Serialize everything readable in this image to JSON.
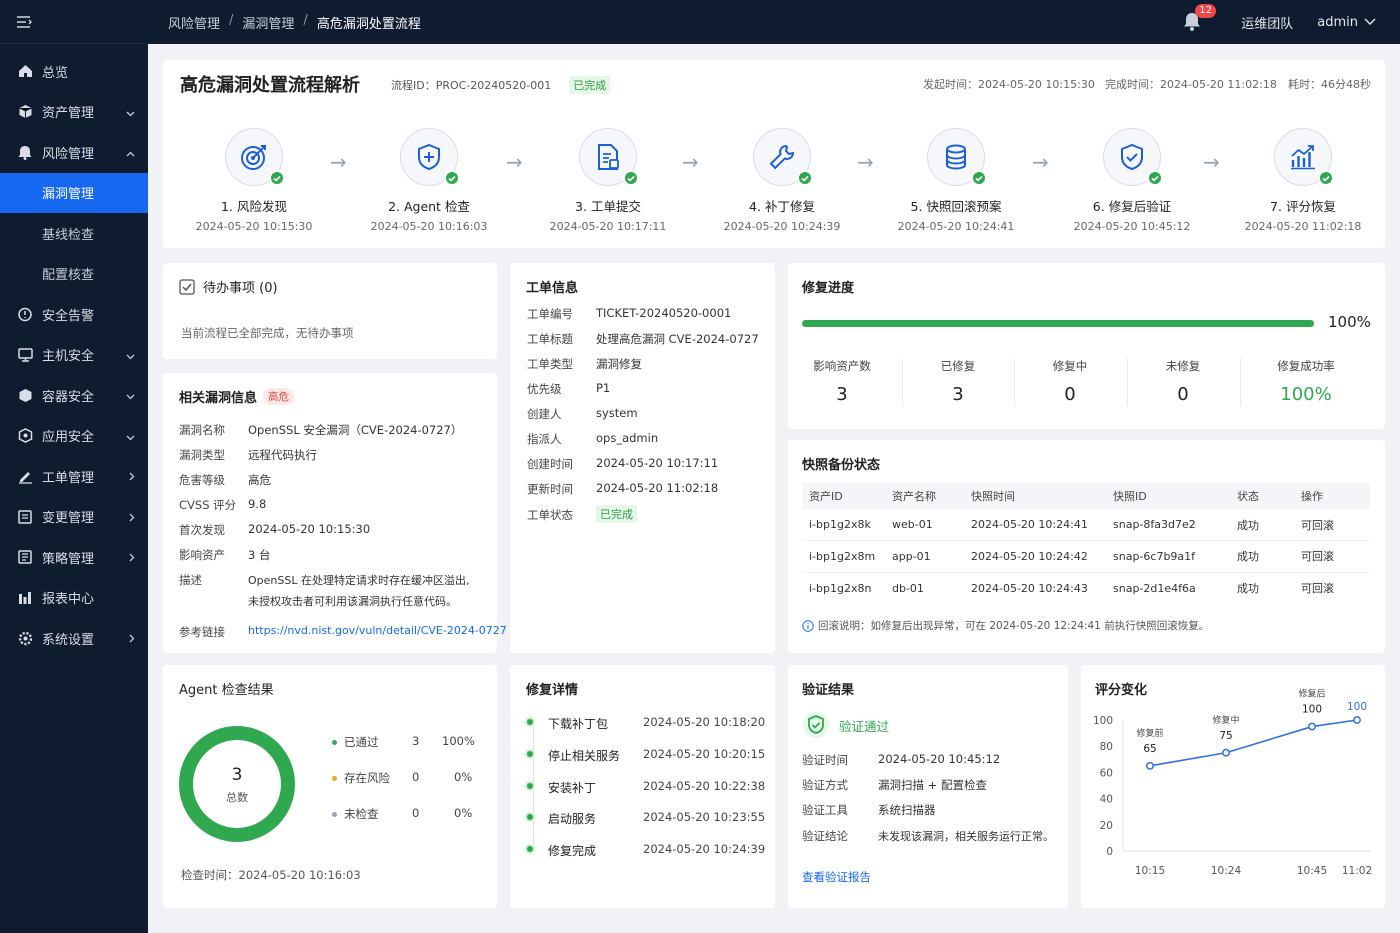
{
  "sidebar": {
    "items": [
      {
        "label": "总览",
        "icon": "home-icon"
      },
      {
        "label": "资产管理",
        "icon": "cube-icon"
      },
      {
        "label": "风险管理",
        "icon": "alert-icon"
      },
      {
        "label": "漏洞管理"
      },
      {
        "label": "基线检查"
      },
      {
        "label": "配置核查"
      },
      {
        "label": "安全告警",
        "icon": "shield-icon"
      },
      {
        "label": "主机安全",
        "icon": "monitor-icon"
      },
      {
        "label": "容器安全",
        "icon": "box-icon"
      },
      {
        "label": "应用安全",
        "icon": "app-icon"
      },
      {
        "label": "工单管理",
        "icon": "edit-icon"
      },
      {
        "label": "变更管理",
        "icon": "list-icon"
      },
      {
        "label": "策略管理",
        "icon": "doc-icon"
      },
      {
        "label": "报表中心",
        "icon": "report-icon"
      },
      {
        "label": "系统设置",
        "icon": "gear-icon"
      }
    ]
  },
  "topbar": {
    "breadcrumb": [
      "风险管理",
      "漏洞管理",
      "高危漏洞处置流程"
    ],
    "notifications": "12",
    "team": "运维团队",
    "user": "admin"
  },
  "header": {
    "title": "高危漏洞处置流程解析",
    "process_id": "流程ID：PROC-20240520-001",
    "status": "已完成",
    "start": "发起时间：2024-05-20 10:15:30",
    "end": "完成时间：2024-05-20 11:02:18",
    "duration": "耗时：46分48秒"
  },
  "steps": [
    {
      "name": "1. 风险发现",
      "time": "2024-05-20 10:15:30",
      "icon": "target-icon"
    },
    {
      "name": "2. Agent 检查",
      "time": "2024-05-20 10:16:03",
      "icon": "shield-plus-icon"
    },
    {
      "name": "3. 工单提交",
      "time": "2024-05-20 10:17:11",
      "icon": "document-icon"
    },
    {
      "name": "4. 补丁修复",
      "time": "2024-05-20 10:24:39",
      "icon": "wrench-icon"
    },
    {
      "name": "5. 快照回滚预案",
      "time": "2024-05-20 10:24:41",
      "icon": "database-icon"
    },
    {
      "name": "6. 修复后验证",
      "time": "2024-05-20 10:45:12",
      "icon": "shield-check-icon"
    },
    {
      "name": "7. 评分恢复",
      "time": "2024-05-20 11:02:18",
      "icon": "bar-chart-icon"
    }
  ],
  "todo": {
    "title": "待办事项 (0)",
    "empty": "当前流程已全部完成，无待办事项"
  },
  "vuln": {
    "title": "相关漏洞信息",
    "level_tag": "高危",
    "rows": [
      {
        "k": "漏洞名称",
        "v": "OpenSSL 安全漏洞（CVE-2024-0727）"
      },
      {
        "k": "漏洞类型",
        "v": "远程代码执行"
      },
      {
        "k": "危害等级",
        "v": "高危"
      },
      {
        "k": "CVSS 评分",
        "v": "9.8"
      },
      {
        "k": "首次发现",
        "v": "2024-05-20 10:15:30"
      },
      {
        "k": "影响资产",
        "v": "3 台"
      }
    ],
    "desc_label": "描述",
    "desc_line1": "OpenSSL 在处理特定请求时存在缓冲区溢出,",
    "desc_line2": "未授权攻击者可利用该漏洞执行任意代码。",
    "ref_label": "参考链接",
    "ref": "https://nvd.nist.gov/vuln/detail/CVE-2024-0727"
  },
  "ticket": {
    "title": "工单信息",
    "rows": [
      {
        "k": "工单编号",
        "v": "TICKET-20240520-0001"
      },
      {
        "k": "工单标题",
        "v": "处理高危漏洞 CVE-2024-0727"
      },
      {
        "k": "工单类型",
        "v": "漏洞修复"
      },
      {
        "k": "优先级",
        "v": "P1"
      },
      {
        "k": "创建人",
        "v": "system"
      },
      {
        "k": "指派人",
        "v": "ops_admin"
      },
      {
        "k": "创建时间",
        "v": "2024-05-20 10:17:11"
      },
      {
        "k": "更新时间",
        "v": "2024-05-20 11:02:18"
      }
    ],
    "status_label": "工单状态",
    "status": "已完成"
  },
  "progress": {
    "title": "修复进度",
    "percent_text": "100%",
    "percent": 100,
    "stats": [
      {
        "label": "影响资产数",
        "value": "3"
      },
      {
        "label": "已修复",
        "value": "3"
      },
      {
        "label": "修复中",
        "value": "0"
      },
      {
        "label": "未修复",
        "value": "0"
      },
      {
        "label": "修复成功率",
        "value": "100%"
      }
    ]
  },
  "snapshot": {
    "title": "快照备份状态",
    "headers": [
      "资产ID",
      "资产名称",
      "快照时间",
      "快照ID",
      "状态",
      "操作"
    ],
    "rows": [
      [
        "i-bp1g2x8k",
        "web-01",
        "2024-05-20 10:24:41",
        "snap-8fa3d7e2",
        "成功",
        "可回滚"
      ],
      [
        "i-bp1g2x8m",
        "app-01",
        "2024-05-20 10:24:42",
        "snap-6c7b9a1f",
        "成功",
        "可回滚"
      ],
      [
        "i-bp1g2x8n",
        "db-01",
        "2024-05-20 10:24:43",
        "snap-2d1e4f6a",
        "成功",
        "可回滚"
      ]
    ],
    "note": "回滚说明：如修复后出现异常，可在 2024-05-20 12:24:41 前执行快照回滚恢复。"
  },
  "agent": {
    "title": "Agent 检查结果",
    "total": "3",
    "total_label": "总数",
    "legend": [
      {
        "label": "已通过",
        "count": "3",
        "pct": "100%",
        "color": "#2fa84f"
      },
      {
        "label": "存在风险",
        "count": "0",
        "pct": "0%",
        "color": "#f5a623"
      },
      {
        "label": "未检查",
        "count": "0",
        "pct": "0%",
        "color": "#9aa3b0"
      }
    ],
    "time": "检查时间：2024-05-20 10:16:03"
  },
  "repair": {
    "title": "修复详情",
    "items": [
      {
        "name": "下载补丁包",
        "time": "2024-05-20 10:18:20"
      },
      {
        "name": "停止相关服务",
        "time": "2024-05-20 10:20:15"
      },
      {
        "name": "安装补丁",
        "time": "2024-05-20 10:22:38"
      },
      {
        "name": "启动服务",
        "time": "2024-05-20 10:23:55"
      },
      {
        "name": "修复完成",
        "time": "2024-05-20 10:24:39"
      }
    ]
  },
  "verify": {
    "title": "验证结果",
    "status": "验证通过",
    "rows": [
      {
        "k": "验证时间",
        "v": "2024-05-20 10:45:12"
      },
      {
        "k": "验证方式",
        "v": "漏洞扫描 + 配置检查"
      },
      {
        "k": "验证工具",
        "v": "系统扫描器"
      },
      {
        "k": "验证结论",
        "v": "未发现该漏洞，相关服务运行正常。"
      }
    ],
    "link": "查看验证报告"
  },
  "chart_data": {
    "type": "line",
    "title": "评分变化",
    "x": [
      "10:15",
      "10:24",
      "10:45",
      "11:02"
    ],
    "values": [
      65,
      75,
      95,
      100
    ],
    "point_labels": [
      "修复前",
      "修复中",
      "修复后",
      ""
    ],
    "data_labels": [
      "65",
      "75",
      "100",
      "100"
    ],
    "ylim": [
      0,
      100
    ],
    "yticks": [
      "0",
      "20",
      "40",
      "60",
      "80",
      "100"
    ],
    "color": "#2f6fe0"
  }
}
